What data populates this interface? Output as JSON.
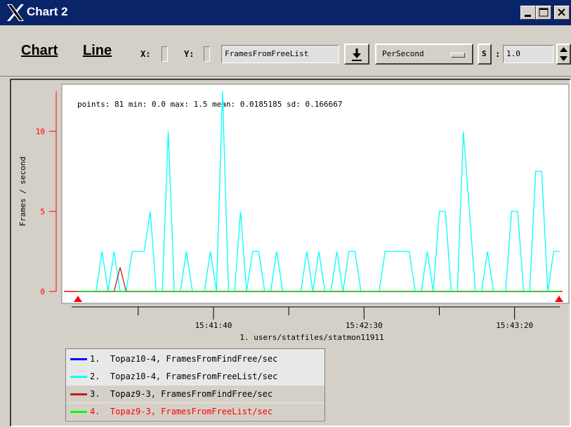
{
  "window": {
    "title": "Chart 2"
  },
  "toolbar": {
    "menu_chart": "Chart",
    "menu_line": "Line",
    "x_label": "X:",
    "y_label": "Y:",
    "metric_field": "FramesFromFreeList",
    "mode_select": "PerSecond",
    "s_label": "S",
    "scale_sep": ":",
    "scale_value": "1.0"
  },
  "chart_data": {
    "type": "line",
    "stats": "points: 81 min: 0.0 max: 1.5 mean: 0.0185185 sd: 0.166667",
    "ylabel": "Frames / second",
    "xlabel": "1. users/statfiles/statmon11911",
    "ylim": [
      0,
      12.5
    ],
    "xlim": [
      0,
      80
    ],
    "yticks": [
      0,
      5,
      10
    ],
    "ytick_labels": [
      "0",
      "5",
      "10"
    ],
    "xticks": [
      {
        "x": 22.5,
        "label": "15:41:40"
      },
      {
        "x": 47.5,
        "label": "15:42:30"
      },
      {
        "x": 72.5,
        "label": "15:43:20"
      }
    ],
    "minor_xticks": [
      10,
      35,
      60
    ],
    "grid": false,
    "colors": {
      "axis_red": "#ff0000",
      "axis_gray": "#000000"
    },
    "series": [
      {
        "name": "1.  Topaz10-4, FramesFromFindFree/sec",
        "color": "#0000ff",
        "values": [
          0,
          0,
          0,
          0,
          0,
          0,
          0,
          0,
          0,
          0,
          0,
          0,
          0,
          0,
          0,
          0,
          0,
          0,
          0,
          0,
          0,
          0,
          0,
          0,
          0,
          0,
          0,
          0,
          0,
          0,
          0,
          0,
          0,
          0,
          0,
          0,
          0,
          0,
          0,
          0,
          0,
          0,
          0,
          0,
          0,
          0,
          0,
          0,
          0,
          0,
          0,
          0,
          0,
          0,
          0,
          0,
          0,
          0,
          0,
          0,
          0,
          0,
          0,
          0,
          0,
          0,
          0,
          0,
          0,
          0,
          0,
          0,
          0,
          0,
          0,
          0,
          0,
          0,
          0,
          0,
          0
        ]
      },
      {
        "name": "2.  Topaz10-4, FramesFromFreeList/sec",
        "color": "#00ffff",
        "values": [
          0,
          0,
          0,
          0,
          2.5,
          0,
          2.5,
          0,
          0,
          2.5,
          2.5,
          2.5,
          5,
          0,
          0,
          10,
          0,
          0,
          2.5,
          0,
          0,
          0,
          2.5,
          0,
          12.5,
          0,
          0,
          5,
          0,
          2.5,
          2.5,
          0,
          0,
          2.5,
          0,
          0,
          0,
          0,
          2.5,
          0,
          2.5,
          0,
          0,
          2.5,
          0,
          2.5,
          2.5,
          0,
          0,
          0,
          0,
          2.5,
          2.5,
          2.5,
          2.5,
          2.5,
          0,
          0,
          2.5,
          0,
          5,
          5,
          0,
          0,
          10,
          5,
          0,
          0,
          2.5,
          0,
          0,
          0,
          5,
          5,
          0,
          0,
          7.5,
          7.5,
          0,
          2.5,
          2.5
        ]
      },
      {
        "name": "3.  Topaz9-3, FramesFromFindFree/sec",
        "color": "#b22222",
        "values": [
          0,
          0,
          0,
          0,
          0,
          0,
          0,
          1.5,
          0,
          0,
          0,
          0,
          0,
          0,
          0,
          0,
          0,
          0,
          0,
          0,
          0,
          0,
          0,
          0,
          0,
          0,
          0,
          0,
          0,
          0,
          0,
          0,
          0,
          0,
          0,
          0,
          0,
          0,
          0,
          0,
          0,
          0,
          0,
          0,
          0,
          0,
          0,
          0,
          0,
          0,
          0,
          0,
          0,
          0,
          0,
          0,
          0,
          0,
          0,
          0,
          0,
          0,
          0,
          0,
          0,
          0,
          0,
          0,
          0,
          0,
          0,
          0,
          0,
          0,
          0,
          0,
          0,
          0,
          0,
          0,
          0
        ]
      },
      {
        "name": "4.  Topaz9-3, FramesFromFreeList/sec",
        "color": "#00ff00",
        "values": [
          0,
          0,
          0,
          0,
          0,
          0,
          0,
          0,
          0,
          0,
          0,
          0,
          0,
          0,
          0,
          0,
          0,
          0,
          0,
          0,
          0,
          0,
          0,
          0,
          0,
          0,
          0,
          0,
          0,
          0,
          0,
          0,
          0,
          0,
          0,
          0,
          0,
          0,
          0,
          0,
          0,
          0,
          0,
          0,
          0,
          0,
          0,
          0,
          0,
          0,
          0,
          0,
          0,
          0,
          0,
          0,
          0,
          0,
          0,
          0,
          0,
          0,
          0,
          0,
          0,
          0,
          0,
          0,
          0,
          0,
          0,
          0,
          0,
          0,
          0,
          0,
          0,
          0,
          0,
          0,
          0
        ]
      }
    ],
    "legend": {
      "placement": "bottom-left",
      "items": [
        {
          "label": "1.  Topaz10-4, FramesFromFindFree/sec",
          "color": "#0000ff",
          "text_color": "#000000",
          "bg": "#e8e8e8"
        },
        {
          "label": "2.  Topaz10-4, FramesFromFreeList/sec",
          "color": "#00ffff",
          "text_color": "#000000",
          "bg": "#e8e8e8"
        },
        {
          "label": "3.  Topaz9-3, FramesFromFindFree/sec",
          "color": "#b22222",
          "text_color": "#000000",
          "bg": "#d4d0c8"
        },
        {
          "label": "4.  Topaz9-3, FramesFromFreeList/sec",
          "color": "#00ff00",
          "text_color": "#ff0000",
          "bg": "#d4d0c8"
        }
      ]
    }
  }
}
